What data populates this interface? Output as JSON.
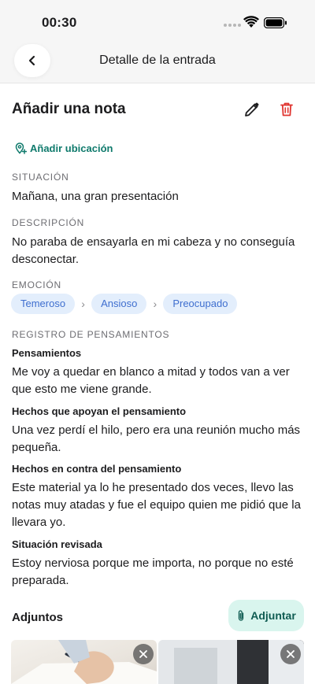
{
  "status_bar": {
    "time": "00:30"
  },
  "nav": {
    "title": "Detalle de la entrada"
  },
  "entry": {
    "title": "Añadir una nota",
    "add_location": "Añadir ubicación"
  },
  "situation": {
    "label": "SITUACIÓN",
    "text": "Mañana, una gran presentación"
  },
  "description": {
    "label": "DESCRIPCIÓN",
    "text": "No paraba de ensayarla en mi cabeza y no conseguía desconectar."
  },
  "emotion": {
    "label": "EMOCIÓN",
    "chips": [
      "Temeroso",
      "Ansioso",
      "Preocupado"
    ]
  },
  "thought_record": {
    "label": "REGISTRO DE PENSAMIENTOS",
    "thoughts_label": "Pensamientos",
    "thoughts_text": "Me voy a quedar en blanco a mitad y todos van a ver que esto me viene grande.",
    "support_label": "Hechos que apoyan el pensamiento",
    "support_text": "Una vez perdí el hilo, pero era una reunión mucho más pequeña.",
    "against_label": "Hechos en contra del pensamiento",
    "against_text": "Este material ya lo he presentado dos veces, llevo las notas muy atadas y fue el equipo quien me pidió que la llevara yo.",
    "revised_label": "Situación revisada",
    "revised_text": "Estoy nerviosa porque me importa, no porque no esté preparada."
  },
  "attachments": {
    "title": "Adjuntos",
    "button_label": "Adjuntar"
  },
  "colors": {
    "accent": "#0f7a6c",
    "delete": "#e0342f",
    "chip_bg": "#e3eefc",
    "chip_text": "#3f6fcf",
    "attach_bg": "#d9f5ee"
  }
}
